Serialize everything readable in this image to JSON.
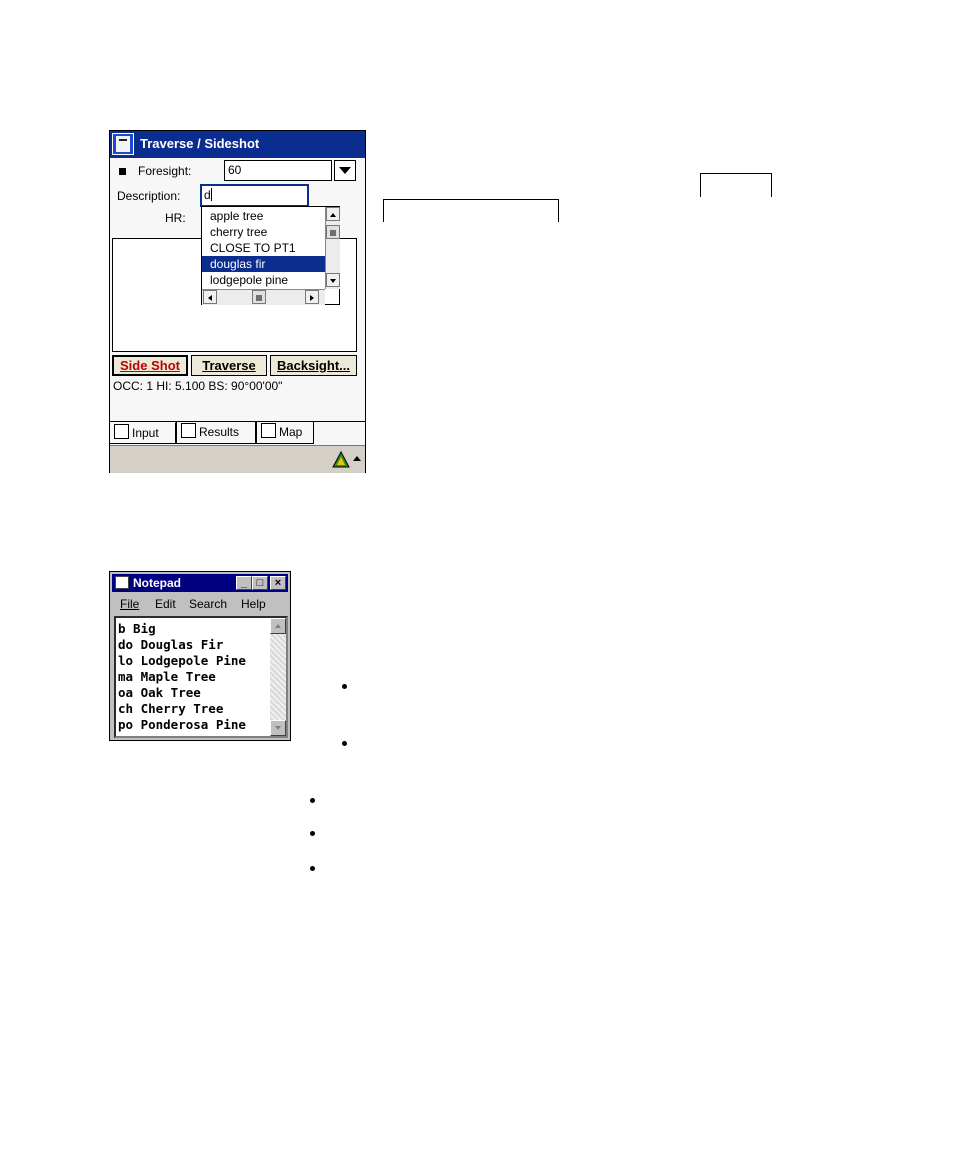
{
  "ppc": {
    "title": "Traverse / Sideshot",
    "foresight_label": "Foresight:",
    "foresight_value": "60",
    "description_label": "Description:",
    "description_value": "d",
    "hr_label": "HR:",
    "autocomplete_items": [
      "apple tree",
      "cherry tree",
      "CLOSE TO PT1",
      "douglas fir",
      "lodgepole pine"
    ],
    "selected_item": "douglas fir",
    "buttons": {
      "side_shot": "Side Shot",
      "traverse": "Traverse",
      "backsight": "Backsight..."
    },
    "status_text": "OCC: 1  HI: 5.100  BS: 90°00'00\"",
    "tabs": [
      "Input",
      "Results",
      "Map"
    ],
    "colors": {
      "title_bar": "#0a2d8f",
      "selection": "#0a2d8f",
      "side_shot_text": "#c00000"
    }
  },
  "notepad": {
    "title": "Notepad",
    "menu": [
      "File",
      "Edit",
      "Search",
      "Help"
    ],
    "lines": [
      "b Big",
      "do Douglas Fir",
      "lo Lodgepole Pine",
      "ma Maple Tree",
      "oa Oak Tree",
      "ch Cherry Tree",
      "po Ponderosa Pine"
    ],
    "window_buttons": {
      "minimize": "_",
      "maximize": "□",
      "close": "×"
    },
    "colors": {
      "title_bar": "#000080"
    }
  }
}
